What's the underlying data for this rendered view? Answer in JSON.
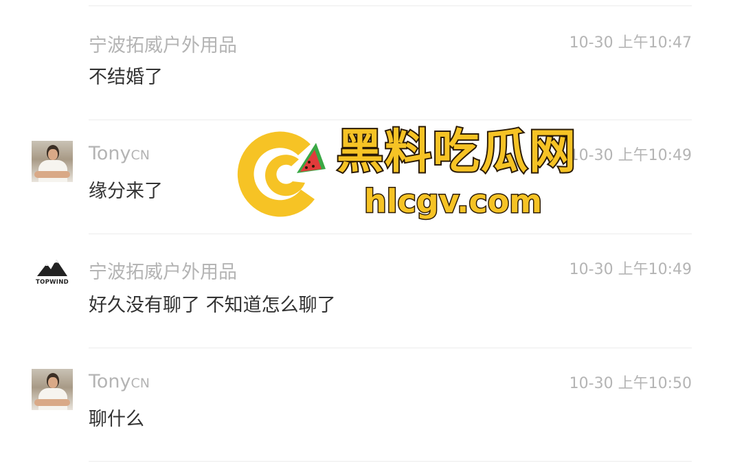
{
  "messages": [
    {
      "sender": "宁波拓威户外用品",
      "sender_suffix": "",
      "avatar": "none",
      "time": "10-30 上午10:47",
      "text": "不结婚了"
    },
    {
      "sender": "Tony",
      "sender_suffix": "CN",
      "avatar": "person-photo",
      "time": "10-30 上午10:49",
      "text": "缘分来了"
    },
    {
      "sender": "宁波拓威户外用品",
      "sender_suffix": "",
      "avatar": "topwind-logo",
      "avatar_brand": "TOPWIND",
      "time": "10-30 上午10:49",
      "text": "好久没有聊了 不知道怎么聊了"
    },
    {
      "sender": "Tony",
      "sender_suffix": "CN",
      "avatar": "person-photo",
      "time": "10-30 上午10:50",
      "text": "聊什么"
    }
  ],
  "watermark": {
    "title": "黑料吃瓜网",
    "domain": "hlcgv.com",
    "colors": {
      "gold": "#f6c325",
      "outline": "#2a1a05",
      "melon_green": "#3aa845",
      "melon_red": "#e23b3b"
    }
  },
  "colors": {
    "meta_text": "#b4b4b4",
    "body_text": "#333333",
    "divider": "#ececec",
    "background": "#ffffff"
  }
}
